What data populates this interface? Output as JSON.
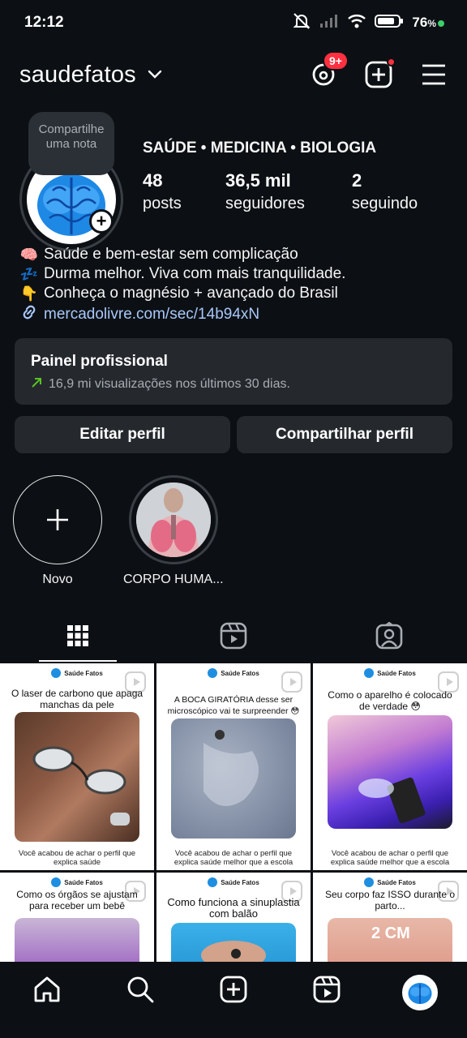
{
  "status_bar": {
    "time": "12:12",
    "battery": "76",
    "battery_unit": "%"
  },
  "header": {
    "username": "saudefatos",
    "threads_badge": "9+"
  },
  "profile": {
    "note_text": "Compartilhe uma nota",
    "categories": "SAÚDE • MEDICINA • BIOLOGIA",
    "stats": [
      {
        "value": "48",
        "label": "posts"
      },
      {
        "value": "36,5 mil",
        "label": "seguidores"
      },
      {
        "value": "2",
        "label": "seguindo"
      }
    ],
    "bio": [
      {
        "emoji": "🧠",
        "text": "Saúde e bem-estar sem complicação"
      },
      {
        "emoji": "💤",
        "text": "Durma melhor. Viva com mais tranquilidade."
      },
      {
        "emoji": "👇",
        "text": "Conheça o magnésio + avançado do Brasil"
      }
    ],
    "link": "mercadolivre.com/sec/14b94xN"
  },
  "panel": {
    "title": "Painel profissional",
    "subtitle": "16,9 mi visualizações nos últimos 30 dias."
  },
  "buttons": {
    "edit": "Editar perfil",
    "share": "Compartilhar perfil"
  },
  "highlights": [
    {
      "label": "Novo"
    },
    {
      "label": "CORPO HUMA..."
    }
  ],
  "posts": [
    {
      "brand": "Saúde Fatos",
      "headline": "O laser de carbono que apaga manchas da pele",
      "caption": "Você acabou de achar o perfil que explica saúde"
    },
    {
      "brand": "Saúde Fatos",
      "headline": "A BOCA GIRATÓRIA desse ser microscópico vai te surpreender 😳",
      "caption": "Você acabou de achar o perfil que explica saúde melhor que a escola"
    },
    {
      "brand": "Saúde Fatos",
      "headline": "Como o aparelho é colocado de verdade 😳",
      "caption": "Você acabou de achar o perfil que explica saúde melhor que a escola"
    },
    {
      "brand": "Saúde Fatos",
      "headline": "Como os órgãos se ajustam para receber um bebê",
      "caption": ""
    },
    {
      "brand": "Saúde Fatos",
      "headline": "Como funciona a sinuplastia com balão",
      "caption": ""
    },
    {
      "brand": "Saúde Fatos",
      "headline": "Seu corpo faz ISSO durante o parto...",
      "overlay": "2 CM",
      "caption": ""
    }
  ],
  "colors": {
    "background": "#0c1014",
    "surface": "#25292e",
    "link": "#a8c7fa",
    "badge": "#ff3040",
    "trend": "#58c322"
  }
}
